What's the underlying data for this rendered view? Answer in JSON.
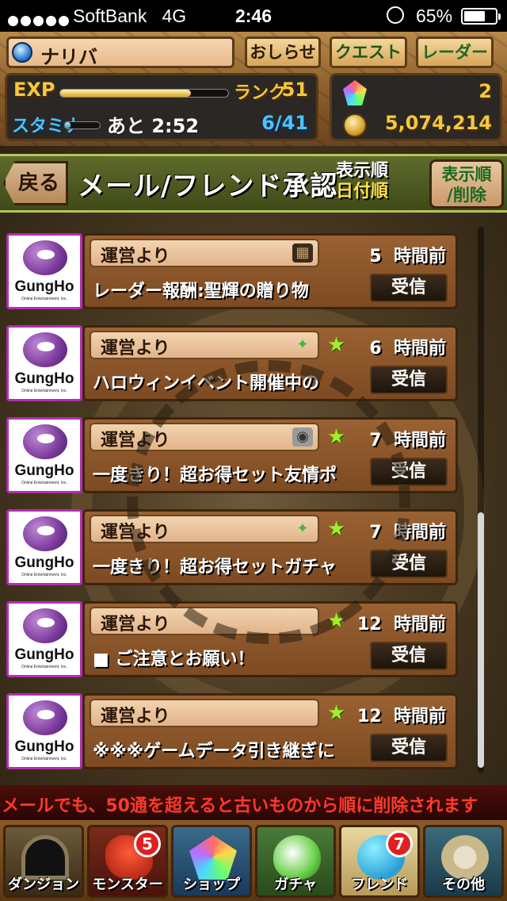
{
  "status_bar": {
    "carrier": "SoftBank",
    "network": "4G",
    "time": "2:46",
    "battery_percent": "65%",
    "battery_level": 0.65
  },
  "header": {
    "player_name": "ナリバ",
    "buttons": {
      "news": "おしらせ",
      "quest": "クエスト",
      "radar": "レーダー"
    },
    "exp_label": "EXP",
    "exp_progress": 0.78,
    "rank_label": "ランク",
    "rank_value": "51",
    "stamina_label": "スタミナ",
    "stamina_progress": 0.15,
    "stamina_recover": "あと 2:52",
    "stamina_value": "6/41",
    "magic_stones": "2",
    "coins": "5,074,214"
  },
  "page": {
    "back_label": "戻る",
    "title": "メール/フレンド承認",
    "sort_line1": "表示順",
    "sort_line2": "日付順",
    "sort_button": "表示順\n/削除"
  },
  "messages": [
    {
      "avatar_logo": "GungHo",
      "avatar_sub": "Online Entertainment, Inc.",
      "sender": "運営より",
      "attachment_icon": "chest-icon",
      "starred": false,
      "time_num": "5",
      "time_unit": "時間前",
      "subject": "レーダー報酬:聖輝の贈り物",
      "button": "受信"
    },
    {
      "avatar_logo": "GungHo",
      "avatar_sub": "Online Entertainment, Inc.",
      "sender": "運営より",
      "attachment_icon": "dragon-icon",
      "starred": true,
      "time_num": "6",
      "time_unit": "時間前",
      "subject": "ハロウィンイベント開催中の",
      "button": "受信"
    },
    {
      "avatar_logo": "GungHo",
      "avatar_sub": "Online Entertainment, Inc.",
      "sender": "運営より",
      "attachment_icon": "egg-machine-icon",
      "starred": true,
      "time_num": "7",
      "time_unit": "時間前",
      "subject": "一度きり！超お得セット友情ポ",
      "button": "受信"
    },
    {
      "avatar_logo": "GungHo",
      "avatar_sub": "Online Entertainment, Inc.",
      "sender": "運営より",
      "attachment_icon": "dragon-icon",
      "starred": true,
      "time_num": "7",
      "time_unit": "時間前",
      "subject": "一度きり！超お得セットガチャ",
      "button": "受信"
    },
    {
      "avatar_logo": "GungHo",
      "avatar_sub": "Online Entertainment, Inc.",
      "sender": "運営より",
      "attachment_icon": "",
      "starred": true,
      "time_num": "12",
      "time_unit": "時間前",
      "subject": "■ ご注意とお願い！",
      "button": "受信"
    },
    {
      "avatar_logo": "GungHo",
      "avatar_sub": "Online Entertainment, Inc.",
      "sender": "運営より",
      "attachment_icon": "",
      "starred": true,
      "time_num": "12",
      "time_unit": "時間前",
      "subject": "※※※ゲームデータ引き継ぎに",
      "button": "受信"
    }
  ],
  "ticker": "メールでも、50通を超えると古いものから順に削除されます",
  "nav": [
    {
      "label": "ダンジョン",
      "icon": "dungeon-gate-icon",
      "badge": ""
    },
    {
      "label": "モンスター",
      "icon": "red-dragon-icon",
      "badge": "5"
    },
    {
      "label": "ショップ",
      "icon": "rainbow-stone-icon",
      "badge": ""
    },
    {
      "label": "ガチャ",
      "icon": "eggs-icon",
      "badge": ""
    },
    {
      "label": "フレンド",
      "icon": "friends-icon",
      "badge": "7"
    },
    {
      "label": "その他",
      "icon": "question-mark-icon",
      "badge": ""
    }
  ],
  "colors": {
    "exp_yellow": "#f3c83c",
    "stamina_blue": "#4cc3ff",
    "ticker_red": "#ff3a2a",
    "avatar_border": "#b22fb0",
    "star_green": "#9ef02a"
  }
}
